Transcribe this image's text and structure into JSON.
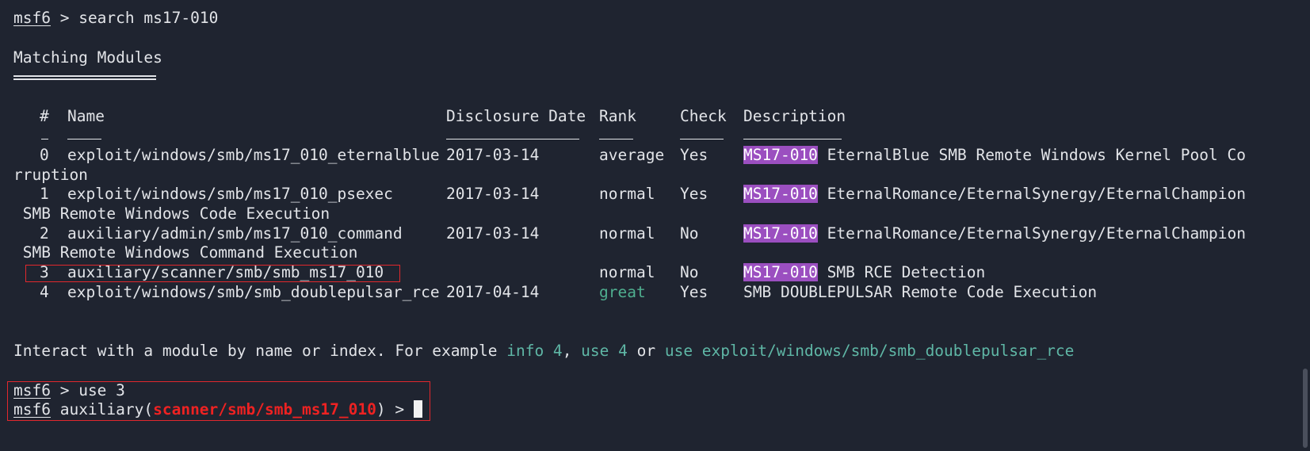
{
  "prompt": {
    "name": "msf6",
    "sep": " > "
  },
  "search_cmd": "search ms17-010",
  "section_title": "Matching Modules",
  "headers": {
    "num": "#",
    "name": "Name",
    "date": "Disclosure Date",
    "rank": "Rank",
    "check": "Check",
    "desc": "Description"
  },
  "rows": [
    {
      "num": "0",
      "name": "exploit/windows/smb/ms17_010_eternalblue",
      "date": "2017-03-14",
      "rank": "average",
      "check": "Yes",
      "tag": "MS17-010",
      "desc": " EternalBlue SMB Remote Windows Kernel Pool Co",
      "desc_wrap": "rruption"
    },
    {
      "num": "1",
      "name": "exploit/windows/smb/ms17_010_psexec",
      "date": "2017-03-14",
      "rank": "normal",
      "check": "Yes",
      "tag": "MS17-010",
      "desc": " EternalRomance/EternalSynergy/EternalChampion",
      "desc_wrap": " SMB Remote Windows Code Execution"
    },
    {
      "num": "2",
      "name": "auxiliary/admin/smb/ms17_010_command",
      "date": "2017-03-14",
      "rank": "normal",
      "check": "No",
      "tag": "MS17-010",
      "desc": " EternalRomance/EternalSynergy/EternalChampion",
      "desc_wrap": " SMB Remote Windows Command Execution"
    },
    {
      "num": "3",
      "name": "auxiliary/scanner/smb/smb_ms17_010",
      "date": "",
      "rank": "normal",
      "check": "No",
      "tag": "MS17-010",
      "desc": " SMB RCE Detection"
    },
    {
      "num": "4",
      "name": "exploit/windows/smb/smb_doublepulsar_rce",
      "date": "2017-04-14",
      "rank": "great",
      "check": "Yes",
      "tag": "",
      "desc": "SMB DOUBLEPULSAR Remote Code Execution"
    }
  ],
  "interact": {
    "pre": "Interact with a module by name or index. For example ",
    "info": "info 4",
    "comma": ", ",
    "use_idx": "use 4",
    "or": " or ",
    "use_path": "use exploit/windows/smb/smb_doublepulsar_rce"
  },
  "use_cmd": "use 3",
  "module_prompt": {
    "prefix": " auxiliary(",
    "module": "scanner/smb/smb_ms17_010",
    "suffix": ") > "
  },
  "colors": {
    "background": "#1f2430",
    "highlight": "#9b4fc0",
    "link": "#5fb7a6",
    "rank_great": "#4fae8f",
    "error_red": "#ee2222",
    "annotation_box": "#e1282d"
  }
}
